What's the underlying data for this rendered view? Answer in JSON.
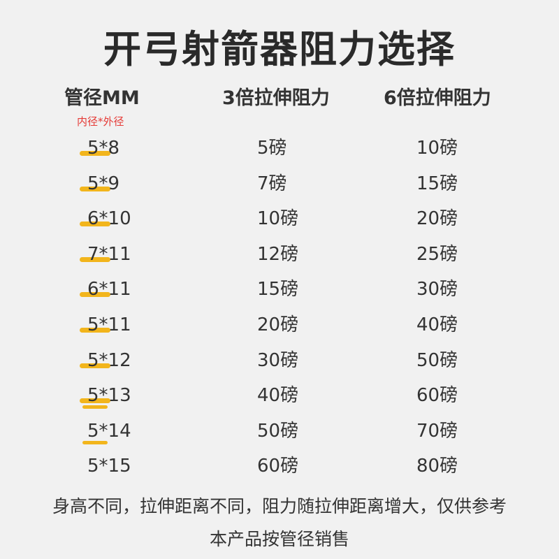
{
  "title": "开弓射箭器阻力选择",
  "headers": {
    "col1": "管径MM",
    "col2": "3倍拉伸阻力",
    "col3": "6倍拉伸阻力"
  },
  "subnote": "内径*外径",
  "rows": [
    {
      "size": "5*8",
      "r3": "5磅",
      "r6": "10磅"
    },
    {
      "size": "5*9",
      "r3": "7磅",
      "r6": "15磅"
    },
    {
      "size": "6*10",
      "r3": "10磅",
      "r6": "20磅"
    },
    {
      "size": "7*11",
      "r3": "12磅",
      "r6": "25磅"
    },
    {
      "size": "6*11",
      "r3": "15磅",
      "r6": "30磅"
    },
    {
      "size": "5*11",
      "r3": "20磅",
      "r6": "40磅"
    },
    {
      "size": "5*12",
      "r3": "30磅",
      "r6": "50磅"
    },
    {
      "size": "5*13",
      "r3": "40磅",
      "r6": "60磅"
    },
    {
      "size": "5*14",
      "r3": "50磅",
      "r6": "70磅"
    },
    {
      "size": "5*15",
      "r3": "60磅",
      "r6": "80磅"
    }
  ],
  "footer": {
    "line1": "身高不同，拉伸距离不同，阻力随拉伸距离增大，仅供参考",
    "line2": "本产品按管径销售"
  },
  "colors": {
    "background": "#f1f1f1",
    "highlight": "#f2b51c",
    "note": "#e53935"
  }
}
